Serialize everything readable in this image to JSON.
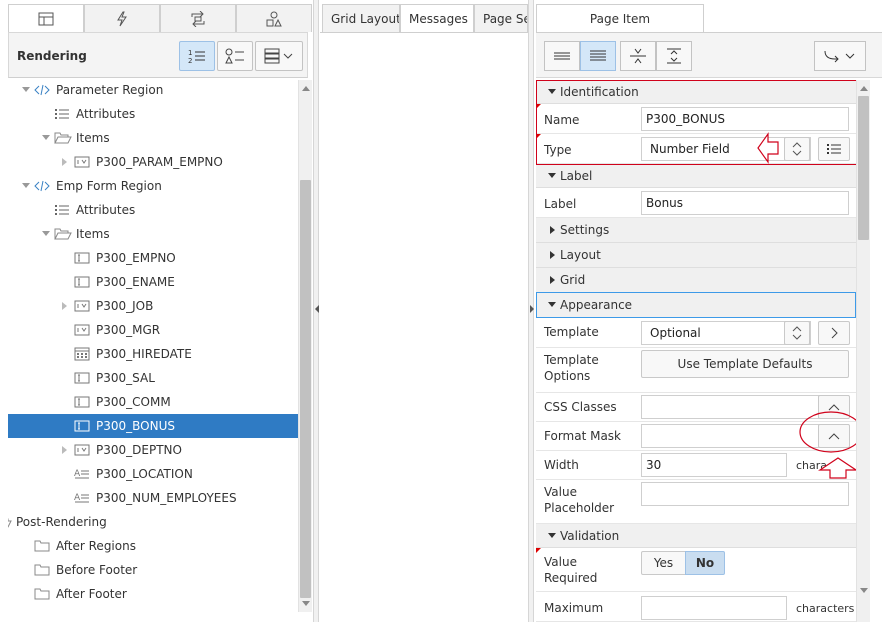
{
  "left_tabs": [
    {
      "icon": "rendering-tree-icon",
      "active": true
    },
    {
      "icon": "lightning-icon",
      "active": false
    },
    {
      "icon": "shared-components-icon",
      "active": false
    },
    {
      "icon": "shapes-icon",
      "active": false
    }
  ],
  "left_header": {
    "title": "Rendering"
  },
  "tree": [
    {
      "label": "Parameter Region",
      "icon": "code-icon",
      "twisty": "down",
      "indent": 0
    },
    {
      "label": "Attributes",
      "icon": "list-icon",
      "twisty": "none",
      "indent": 1
    },
    {
      "label": "Items",
      "icon": "folder-open-icon",
      "twisty": "down",
      "indent": 1
    },
    {
      "label": "P300_PARAM_EMPNO",
      "icon": "select-list-icon",
      "twisty": "right",
      "indent": 2
    },
    {
      "label": "Emp Form Region",
      "icon": "code-icon",
      "twisty": "down",
      "indent": 0
    },
    {
      "label": "Attributes",
      "icon": "list-icon",
      "twisty": "none",
      "indent": 1
    },
    {
      "label": "Items",
      "icon": "folder-open-icon",
      "twisty": "down",
      "indent": 1
    },
    {
      "label": "P300_EMPNO",
      "icon": "text-field-icon",
      "twisty": "none",
      "indent": 2
    },
    {
      "label": "P300_ENAME",
      "icon": "text-field-icon",
      "twisty": "none",
      "indent": 2
    },
    {
      "label": "P300_JOB",
      "icon": "select-list-icon",
      "twisty": "right",
      "indent": 2
    },
    {
      "label": "P300_MGR",
      "icon": "select-list-icon",
      "twisty": "none",
      "indent": 2
    },
    {
      "label": "P300_HIREDATE",
      "icon": "date-picker-icon",
      "twisty": "none",
      "indent": 2
    },
    {
      "label": "P300_SAL",
      "icon": "text-field-icon",
      "twisty": "none",
      "indent": 2
    },
    {
      "label": "P300_COMM",
      "icon": "text-field-icon",
      "twisty": "none",
      "indent": 2
    },
    {
      "label": "P300_BONUS",
      "icon": "text-field-icon",
      "twisty": "none",
      "indent": 2,
      "selected": true
    },
    {
      "label": "P300_DEPTNO",
      "icon": "select-list-icon",
      "twisty": "right",
      "indent": 2
    },
    {
      "label": "P300_LOCATION",
      "icon": "display-only-icon",
      "twisty": "none",
      "indent": 2
    },
    {
      "label": "P300_NUM_EMPLOYEES",
      "icon": "display-only-icon",
      "twisty": "none",
      "indent": 2
    },
    {
      "label": "Post-Rendering",
      "icon": "folder-open-icon",
      "twisty": "down",
      "indent": -1
    },
    {
      "label": "After Regions",
      "icon": "folder-icon",
      "twisty": "none",
      "indent": 0
    },
    {
      "label": "Before Footer",
      "icon": "folder-icon",
      "twisty": "none",
      "indent": 0
    },
    {
      "label": "After Footer",
      "icon": "folder-icon",
      "twisty": "none",
      "indent": 0
    }
  ],
  "middle_tabs": [
    {
      "label": "Grid Layout",
      "active": false
    },
    {
      "label": "Messages",
      "active": true
    },
    {
      "label": "Page Se",
      "active": false
    }
  ],
  "right": {
    "tab_label": "Page Item",
    "groups": {
      "identification": "Identification",
      "label": "Label",
      "settings": "Settings",
      "layout": "Layout",
      "grid": "Grid",
      "appearance": "Appearance",
      "validation": "Validation"
    },
    "fields": {
      "name_label": "Name",
      "name_value": "P300_BONUS",
      "type_label": "Type",
      "type_value": "Number Field",
      "label_label": "Label",
      "label_value": "Bonus",
      "template_label": "Template",
      "template_value": "Optional",
      "template_options_label": "Template Options",
      "template_defaults_button": "Use Template Defaults",
      "css_classes_label": "CSS Classes",
      "css_classes_value": "",
      "format_mask_label": "Format Mask",
      "format_mask_value": "",
      "width_label": "Width",
      "width_value": "30",
      "width_unit": "chara",
      "placeholder_label": "Value Placeholder",
      "placeholder_value": "",
      "value_required_label": "Value Required",
      "yes_label": "Yes",
      "no_label": "No",
      "maximum_label": "Maximum",
      "maximum_unit": "characters"
    }
  },
  "colors": {
    "selected_row": "#2f7bc4",
    "annotation_red": "#d0021b",
    "focus_blue": "#3d9ae8"
  }
}
